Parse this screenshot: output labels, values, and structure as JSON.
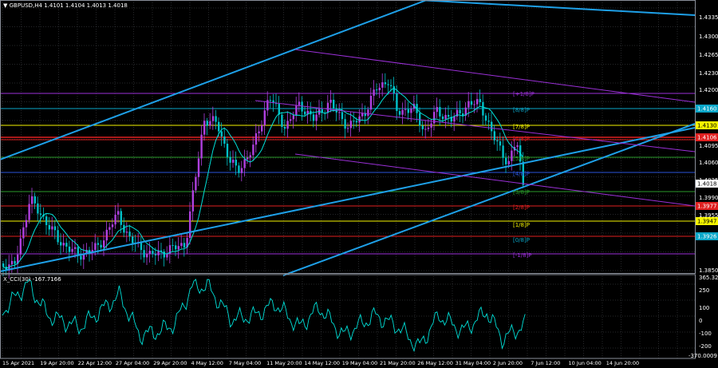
{
  "header": {
    "symbol_info": "GBPUSD,H4  1.4101 1.4104 1.4013 1.4018"
  },
  "indicator": {
    "label": "X_CCI(30) -167.7166"
  },
  "price_axis": {
    "ticks": [
      "1.4335",
      "1.4300",
      "1.4265",
      "1.4230",
      "1.4200",
      "1.4095",
      "1.4060",
      "1.4025",
      "1.3990",
      "1.3955",
      "1.3850"
    ],
    "badges": [
      {
        "text": "1.4160",
        "color": "#0aa6c8"
      },
      {
        "text": "1.4130",
        "color": "#f5f500"
      },
      {
        "text": "1.4106",
        "color": "#e02020"
      },
      {
        "text": "1.4018",
        "color": "#ffffff"
      },
      {
        "text": "1.3977",
        "color": "#e02020"
      },
      {
        "text": "1.3947",
        "color": "#f5f500"
      },
      {
        "text": "1.3926",
        "color": "#0aa6c8"
      }
    ]
  },
  "cci_axis": {
    "ticks": [
      "365.3238",
      "250",
      "100",
      "0",
      "-100",
      "-200"
    ],
    "bottom": "-370.0009"
  },
  "murrey_labels": [
    {
      "text": "[+1/8]P",
      "color": "#9b30d8"
    },
    {
      "text": "[8/8]P",
      "color": "#0aa6c8"
    },
    {
      "text": "[7/8]P",
      "color": "#f5f500"
    },
    {
      "text": "[6/8]P",
      "color": "#e02020"
    },
    {
      "text": "[5/8]P",
      "color": "#2a9a2a"
    },
    {
      "text": "[4/8]P",
      "color": "#2a55d8"
    },
    {
      "text": "[3/8]P",
      "color": "#2a9a2a"
    },
    {
      "text": "[2/8]P",
      "color": "#e02020"
    },
    {
      "text": "[1/8]P",
      "color": "#f5f500"
    },
    {
      "text": "[0/8]P",
      "color": "#0aa6c8"
    },
    {
      "text": "[-1/8]P",
      "color": "#9b30d8"
    }
  ],
  "time_axis": [
    "15 Apr 2021",
    "19 Apr 20:00",
    "22 Apr 12:00",
    "27 Apr 04:00",
    "29 Apr 20:00",
    "4 May 12:00",
    "7 May 04:00",
    "11 May 20:00",
    "14 May 12:00",
    "19 May 04:00",
    "21 May 20:00",
    "26 May 12:00",
    "31 May 04:00",
    "2 Jun 20:00",
    "7 Jun 12:00",
    "10 Jun 04:00",
    "14 Jun 20:00"
  ],
  "colors": {
    "bull": "#b040e0",
    "bear": "#00c0c8",
    "ma": "#00e0d8",
    "channel": "#1ea0e8",
    "trend": "#9b30d8",
    "grid": "#8a8f9a"
  }
}
